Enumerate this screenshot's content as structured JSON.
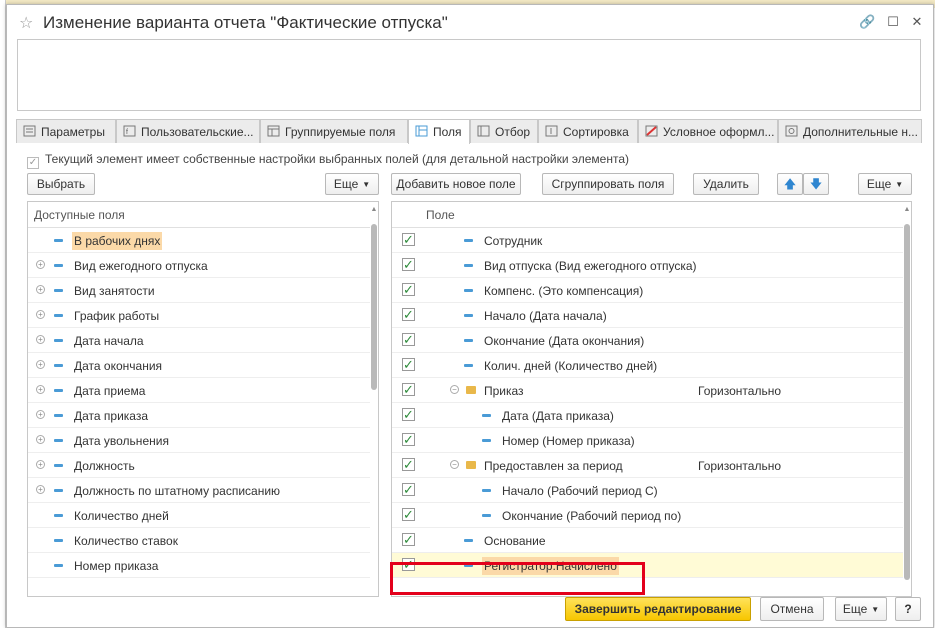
{
  "window": {
    "title": "Изменение варианта отчета \"Фактические отпуска\""
  },
  "tabs": [
    {
      "label": "Параметры",
      "icon": "parameters-icon"
    },
    {
      "label": "Пользовательские...",
      "icon": "user-fields-icon"
    },
    {
      "label": "Группируемые поля",
      "icon": "grouped-fields-icon"
    },
    {
      "label": "Поля",
      "icon": "fields-icon",
      "active": true
    },
    {
      "label": "Отбор",
      "icon": "filter-icon"
    },
    {
      "label": "Сортировка",
      "icon": "sort-icon"
    },
    {
      "label": "Условное оформл...",
      "icon": "conditional-format-icon"
    },
    {
      "label": "Дополнительные н...",
      "icon": "additional-settings-icon"
    }
  ],
  "own_settings": {
    "label": "Текущий элемент имеет собственные настройки выбранных полей (для детальной настройки элемента)"
  },
  "left_toolbar": {
    "select": "Выбрать",
    "more": "Еще"
  },
  "right_toolbar": {
    "add": "Добавить новое поле",
    "group": "Сгруппировать поля",
    "delete": "Удалить",
    "more": "Еще"
  },
  "available_fields": {
    "header": "Доступные поля",
    "items": [
      "В рабочих днях",
      "Вид ежегодного отпуска",
      "Вид занятости",
      "График работы",
      "Дата начала",
      "Дата окончания",
      "Дата приема",
      "Дата приказа",
      "Дата увольнения",
      "Должность",
      "Должность по штатному расписанию",
      "Количество дней",
      "Количество ставок",
      "Номер приказа"
    ]
  },
  "selected_fields": {
    "header": "Поле",
    "placement": "Горизонтально",
    "items": [
      "Сотрудник",
      "Вид отпуска (Вид ежегодного отпуска)",
      "Компенс. (Это компенсация)",
      "Начало (Дата начала)",
      "Окончание (Дата окончания)",
      "Колич. дней (Количество дней)",
      "Приказ",
      "Дата (Дата приказа)",
      "Номер (Номер приказа)",
      "Предоставлен за период",
      "Начало (Рабочий период С)",
      "Окончание (Рабочий период по)",
      "Основание",
      "Регистратор.Начислено"
    ]
  },
  "footer": {
    "finish": "Завершить редактирование",
    "cancel": "Отмена",
    "more": "Еще",
    "help": "?"
  },
  "colors": {
    "primary_button": "#f7c600",
    "highlight": "#fbd9a8",
    "selected_row": "#fffbd6",
    "annotation_box": "#e3001b",
    "check": "#2e8b3a"
  }
}
